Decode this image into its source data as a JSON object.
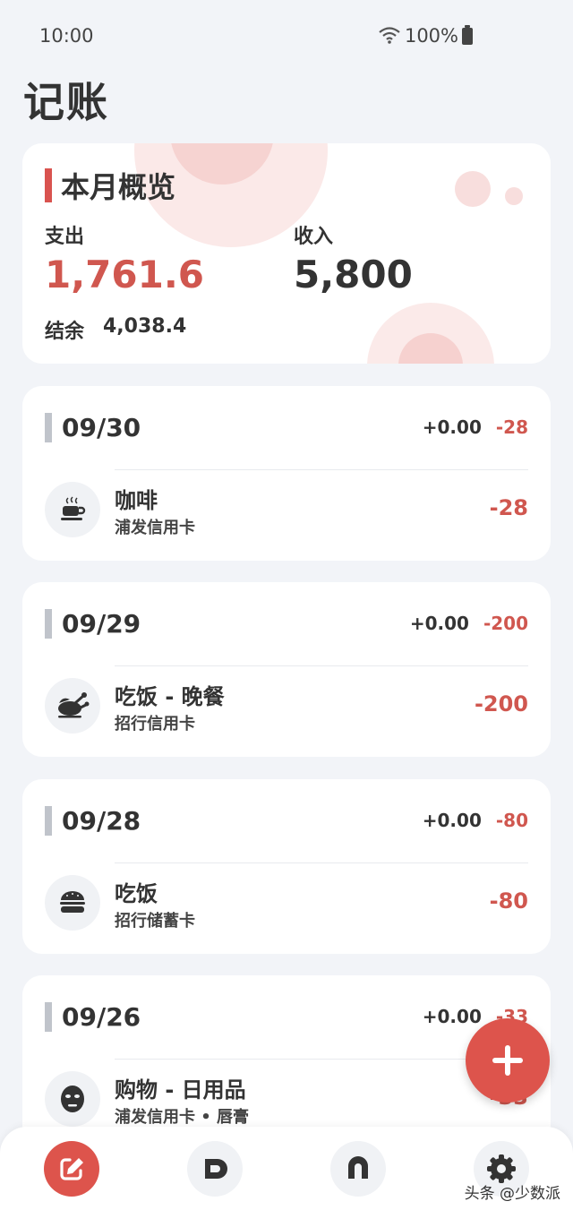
{
  "status_bar": {
    "time": "10:00",
    "battery": "100%"
  },
  "page_title": "记账",
  "overview": {
    "title": "本月概览",
    "expense_label": "支出",
    "expense_value": "1,761.6",
    "income_label": "收入",
    "income_value": "5,800",
    "balance_label": "结余",
    "balance_value": "4,038.4"
  },
  "days": [
    {
      "date": "09/30",
      "income": "+0.00",
      "expense": "-28",
      "item": {
        "name": "咖啡",
        "account": "浦发信用卡",
        "amount": "-28",
        "icon": "coffee-icon"
      }
    },
    {
      "date": "09/29",
      "income": "+0.00",
      "expense": "-200",
      "item": {
        "name": "吃饭 - 晚餐",
        "account": "招行信用卡",
        "amount": "-200",
        "icon": "chicken-icon"
      }
    },
    {
      "date": "09/28",
      "income": "+0.00",
      "expense": "-80",
      "item": {
        "name": "吃饭",
        "account": "招行储蓄卡",
        "amount": "-80",
        "icon": "burger-icon"
      }
    },
    {
      "date": "09/26",
      "income": "+0.00",
      "expense": "-33",
      "item": {
        "name": "购物 - 日用品",
        "account": "浦发信用卡 • 唇膏",
        "amount": "-33",
        "icon": "face-mask-icon"
      }
    }
  ],
  "bottom_nav": [
    "edit-icon",
    "ledger-icon",
    "stats-icon",
    "gear-icon"
  ],
  "colors": {
    "accent": "#dd544c",
    "expense": "#d0574f",
    "background": "#f2f4f8"
  },
  "watermark": "头条 @少数派"
}
